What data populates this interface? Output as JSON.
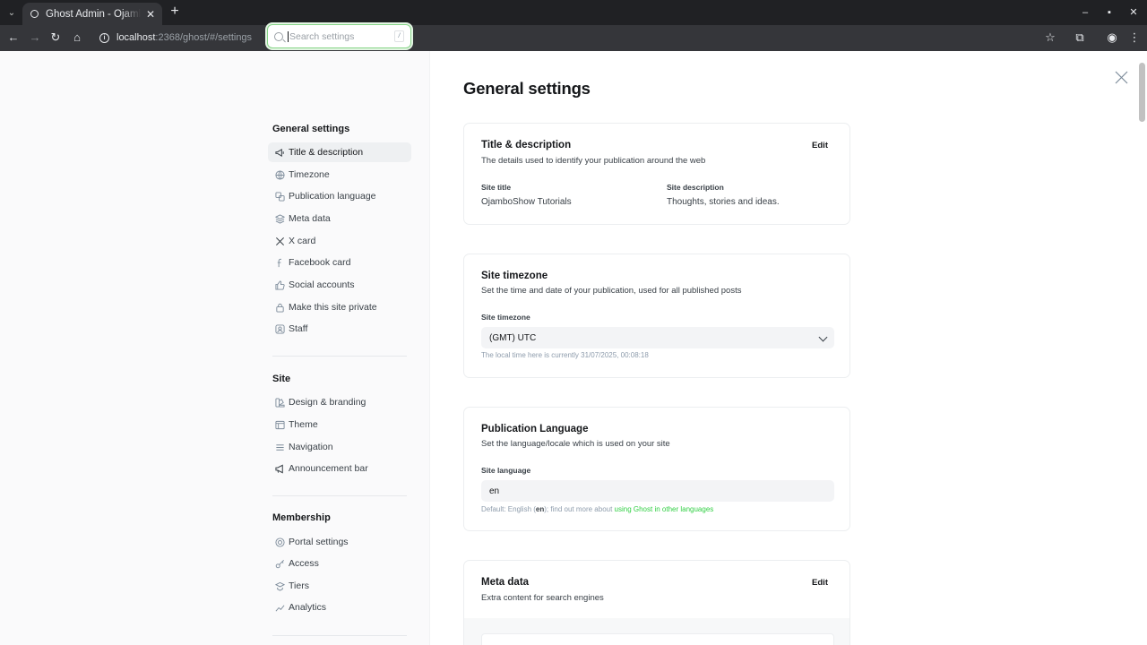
{
  "browser": {
    "tab_title": "Ghost Admin - OjamboShow Tutorials",
    "tab_close": "✕",
    "new_tab": "+",
    "url_host": "localhost",
    "url_path": ":2368/ghost/#/settings"
  },
  "search": {
    "placeholder": "Search settings",
    "shortcut": "/"
  },
  "sidebar": {
    "general": {
      "title": "General settings",
      "items": [
        {
          "label": "Title & description",
          "icon": "megaphone-icon"
        },
        {
          "label": "Timezone",
          "icon": "globe-icon"
        },
        {
          "label": "Publication language",
          "icon": "translate-icon"
        },
        {
          "label": "Meta data",
          "icon": "layers-icon"
        },
        {
          "label": "X card",
          "icon": "x-logo-icon"
        },
        {
          "label": "Facebook card",
          "icon": "facebook-icon"
        },
        {
          "label": "Social accounts",
          "icon": "thumbs-up-icon"
        },
        {
          "label": "Make this site private",
          "icon": "lock-icon"
        },
        {
          "label": "Staff",
          "icon": "users-icon"
        }
      ]
    },
    "site": {
      "title": "Site",
      "items": [
        {
          "label": "Design & branding",
          "icon": "palette-icon"
        },
        {
          "label": "Theme",
          "icon": "layout-icon"
        },
        {
          "label": "Navigation",
          "icon": "hamburger-icon"
        },
        {
          "label": "Announcement bar",
          "icon": "bullhorn-icon"
        }
      ]
    },
    "membership": {
      "title": "Membership",
      "items": [
        {
          "label": "Portal settings",
          "icon": "portal-icon"
        },
        {
          "label": "Access",
          "icon": "key-icon"
        },
        {
          "label": "Tiers",
          "icon": "tiers-icon"
        },
        {
          "label": "Analytics",
          "icon": "chart-icon"
        }
      ]
    }
  },
  "main": {
    "title": "General settings",
    "title_description": {
      "title": "Title & description",
      "description": "The details used to identify your publication around the web",
      "edit_label": "Edit",
      "site_title_label": "Site title",
      "site_title_value": "OjamboShow Tutorials",
      "site_description_label": "Site description",
      "site_description_value": "Thoughts, stories and ideas."
    },
    "timezone": {
      "title": "Site timezone",
      "description": "Set the time and date of your publication, used for all published posts",
      "label": "Site timezone",
      "value": "(GMT) UTC",
      "hint": "The local time here is currently 31/07/2025, 00:08:18"
    },
    "language": {
      "title": "Publication Language",
      "description": "Set the language/locale which is used on your site",
      "label": "Site language",
      "value": "en",
      "hint_prefix": "Default: English (",
      "hint_code": "en",
      "hint_middle": "); find out more about ",
      "hint_link": "using Ghost in other languages"
    },
    "meta": {
      "title": "Meta data",
      "description": "Extra content for search engines",
      "edit_label": "Edit"
    }
  },
  "colors": {
    "accent": "#30cf43",
    "sidebar_bg": "#fafafb",
    "active_item": "#eef0f2"
  }
}
